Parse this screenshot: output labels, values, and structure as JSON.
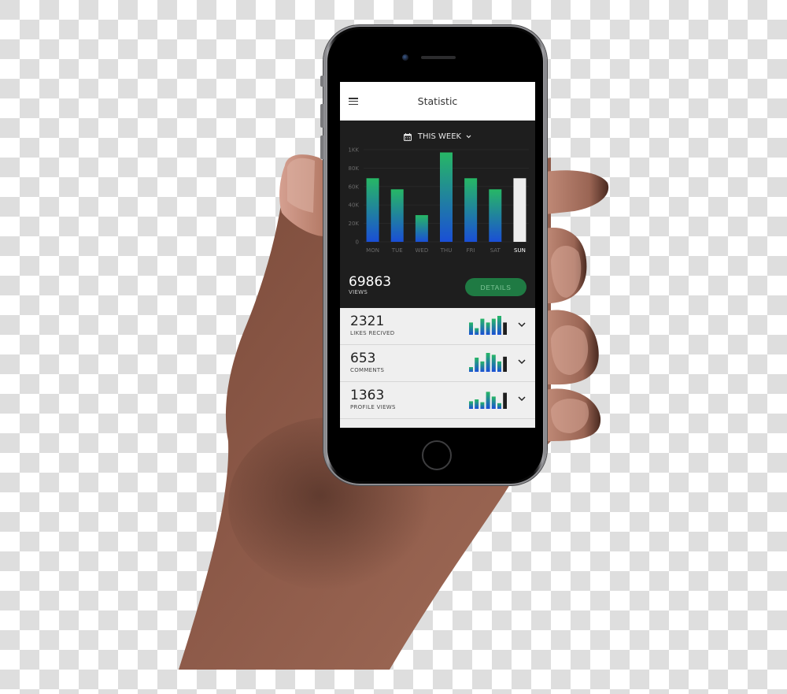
{
  "app": {
    "title": "Statistic",
    "menu_icon": "hamburger-menu-icon"
  },
  "period_selector": {
    "icon": "calendar-icon",
    "label": "THIS WEEK",
    "chevron": "chevron-down-icon"
  },
  "chart_data": {
    "type": "bar",
    "title": "",
    "xlabel": "",
    "ylabel": "",
    "categories": [
      "MON",
      "TUE",
      "WED",
      "THU",
      "FRI",
      "SAT",
      "SUN"
    ],
    "values": [
      69000,
      57000,
      29000,
      97000,
      69000,
      57000,
      69000
    ],
    "selected_category": "SUN",
    "y_ticks": [
      0,
      20000,
      40000,
      60000,
      80000,
      100000
    ],
    "y_tick_labels": [
      "0",
      "20K",
      "40K",
      "60K",
      "80K",
      "1KK"
    ],
    "ylim": [
      0,
      100000
    ],
    "grid": true,
    "colors": {
      "bar_gradient_top": "#27b765",
      "bar_gradient_bottom": "#1a4fd6",
      "selected_bar": "#eeeeee",
      "background": "#1e1e1e",
      "axis_label": "#6a6a6a",
      "selected_label": "#ffffff"
    }
  },
  "summary": {
    "views_value": "69863",
    "views_label": "VIEWS",
    "details_button": "DETAILS",
    "accent": "#1f7a43"
  },
  "stats": [
    {
      "value": "2321",
      "label": "LIKES RECIVED",
      "trend": [
        0.65,
        0.35,
        0.85,
        0.65,
        0.85,
        1.0,
        0.65
      ],
      "chevron": "chevron-down-icon"
    },
    {
      "value": "653",
      "label": "COMMENTS",
      "trend": [
        0.25,
        0.75,
        0.55,
        1.0,
        0.9,
        0.55,
        0.8
      ],
      "chevron": "chevron-down-icon"
    },
    {
      "value": "1363",
      "label": "PROFILE VIEWS",
      "trend": [
        0.4,
        0.5,
        0.35,
        0.9,
        0.65,
        0.3,
        0.85
      ],
      "chevron": "chevron-down-icon"
    }
  ]
}
